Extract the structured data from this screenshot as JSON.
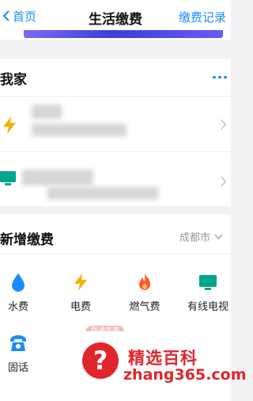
{
  "nav": {
    "back_label": "首页",
    "title": "生活缴费",
    "record_label": "缴费记录"
  },
  "my_home": {
    "title": "我家"
  },
  "new_payment": {
    "title": "新增缴费",
    "city": "成都市",
    "items": [
      {
        "label": "水费",
        "icon": "water-drop-icon",
        "color": "#1a8cff"
      },
      {
        "label": "电费",
        "icon": "lightning-icon",
        "color": "#f5b100"
      },
      {
        "label": "燃气费",
        "icon": "flame-icon",
        "color": "#ff5a1f"
      },
      {
        "label": "有线电视",
        "icon": "tv-icon",
        "color": "#00a58e"
      },
      {
        "label": "固话",
        "icon": "telephone-icon",
        "color": "#1a8cff"
      }
    ],
    "promo_badge": "联通宽带"
  },
  "watermark": {
    "title": "精选百科",
    "domain": "zhang365.com",
    "symbol": "?"
  },
  "colors": {
    "accent": "#1a8cff",
    "background": "#f2f2f4",
    "watermark_red": "#e0262c"
  }
}
